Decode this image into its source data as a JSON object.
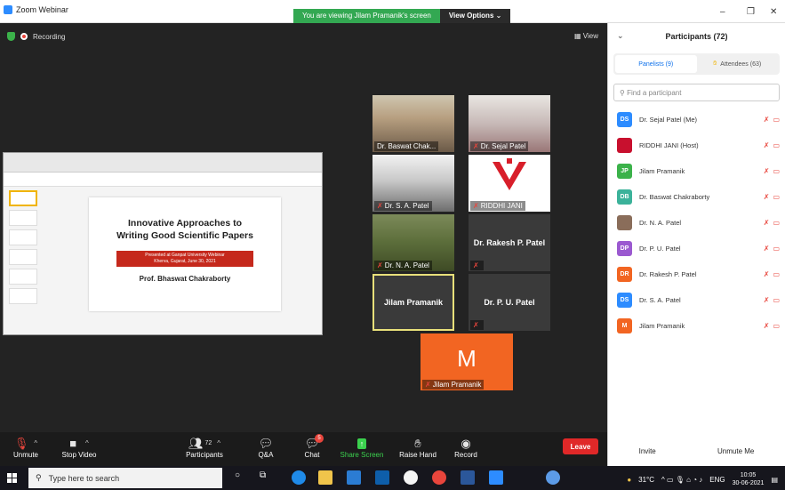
{
  "window": {
    "app_title": "Zoom Webinar",
    "share_banner": "You are viewing Jilam Pramanik's screen",
    "view_options": "View Options ⌄",
    "minimize": "–",
    "restore": "❐",
    "close": "✕"
  },
  "main": {
    "recording_label": "Recording",
    "view_label": "View"
  },
  "slide": {
    "title_line1": "Innovative Approaches to",
    "title_line2": "Writing Good Scientific Papers",
    "banner_line1": "Presented at Ganpat University Webinar",
    "banner_line2": "Kherva, Gujarat, June 30, 2021",
    "author": "Prof. Bhaswat Chakraborty"
  },
  "tiles": [
    {
      "name": "Dr. Baswat Chak...",
      "muted": false
    },
    {
      "name": "Dr. Sejal Patel",
      "muted": true
    },
    {
      "name": "Dr. S. A. Patel",
      "muted": true
    },
    {
      "name": "RIDDHI JANI",
      "muted": true
    },
    {
      "name": "Dr. N. A. Patel",
      "muted": true
    },
    {
      "name": "Dr. Rakesh P. Patel",
      "muted": true
    },
    {
      "name": "Jilam Pramanik",
      "muted": false
    },
    {
      "name": "Dr. P. U. Patel",
      "muted": true
    },
    {
      "name": "Jilam Pramanik",
      "muted": true,
      "initial": "M"
    }
  ],
  "controls": {
    "unmute": "Unmute",
    "stop_video": "Stop Video",
    "participants": "Participants",
    "participants_count": "72",
    "qa": "Q&A",
    "chat": "Chat",
    "chat_badge": "5",
    "share_screen": "Share Screen",
    "raise_hand": "Raise Hand",
    "record": "Record",
    "leave": "Leave"
  },
  "panel": {
    "title": "Participants (72)",
    "tab_panelists": "Panelists (9)",
    "tab_attendees": "Attendees (63)",
    "search_placeholder": "Find a participant",
    "invite": "Invite",
    "unmute_me": "Unmute Me",
    "participants": [
      {
        "initials": "DS",
        "name": "Dr. Sejal Patel (Me)",
        "color": "#2d8cff"
      },
      {
        "initials": "",
        "name": "RIDDHI JANI (Host)",
        "color": "#c8102e"
      },
      {
        "initials": "JP",
        "name": "Jilam Pramanik",
        "color": "#3bb24a"
      },
      {
        "initials": "DB",
        "name": "Dr. Baswat Chakraborty",
        "color": "#3bb29a"
      },
      {
        "initials": "",
        "name": "Dr. N. A. Patel",
        "color": "#8a6d5a"
      },
      {
        "initials": "DP",
        "name": "Dr. P. U. Patel",
        "color": "#9b59d0"
      },
      {
        "initials": "DR",
        "name": "Dr. Rakesh P. Patel",
        "color": "#f26522"
      },
      {
        "initials": "DS",
        "name": "Dr. S. A. Patel",
        "color": "#2d8cff"
      },
      {
        "initials": "M",
        "name": "Jilam Pramanik",
        "color": "#f26522"
      }
    ]
  },
  "taskbar": {
    "search_placeholder": "Type here to search",
    "temperature": "31°C",
    "language": "ENG",
    "time": "10:05",
    "date": "30-06-2021"
  },
  "colors": {
    "zoom_blue": "#2d8cff",
    "banner_green": "#33a852",
    "leave_red": "#e02828",
    "share_green": "#3bd14e"
  }
}
